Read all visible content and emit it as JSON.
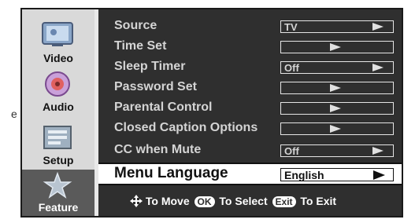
{
  "sidebar": {
    "items": [
      {
        "label": "Video",
        "icon": "video-icon"
      },
      {
        "label": "Audio",
        "icon": "audio-icon"
      },
      {
        "label": "Setup",
        "icon": "setup-icon"
      },
      {
        "label": "Feature",
        "icon": "feature-icon",
        "active": true
      }
    ]
  },
  "menu": {
    "rows": [
      {
        "label": "Source",
        "value": "TV"
      },
      {
        "label": "Time Set",
        "value": ""
      },
      {
        "label": "Sleep Timer",
        "value": "Off"
      },
      {
        "label": "Password Set",
        "value": ""
      },
      {
        "label": "Parental Control",
        "value": ""
      },
      {
        "label": "Closed Caption Options",
        "value": ""
      },
      {
        "label": "CC when Mute",
        "value": "Off"
      }
    ],
    "selected": {
      "label": "Menu Language",
      "value": "English"
    }
  },
  "help": {
    "move": "To Move",
    "ok_key": "OK",
    "select": "To Select",
    "exit_key": "Exit",
    "exit": "To Exit"
  },
  "colors": {
    "panel": "#2f2f2f",
    "sidebar": "#d9d9d9",
    "text": "#d4d4d4"
  }
}
